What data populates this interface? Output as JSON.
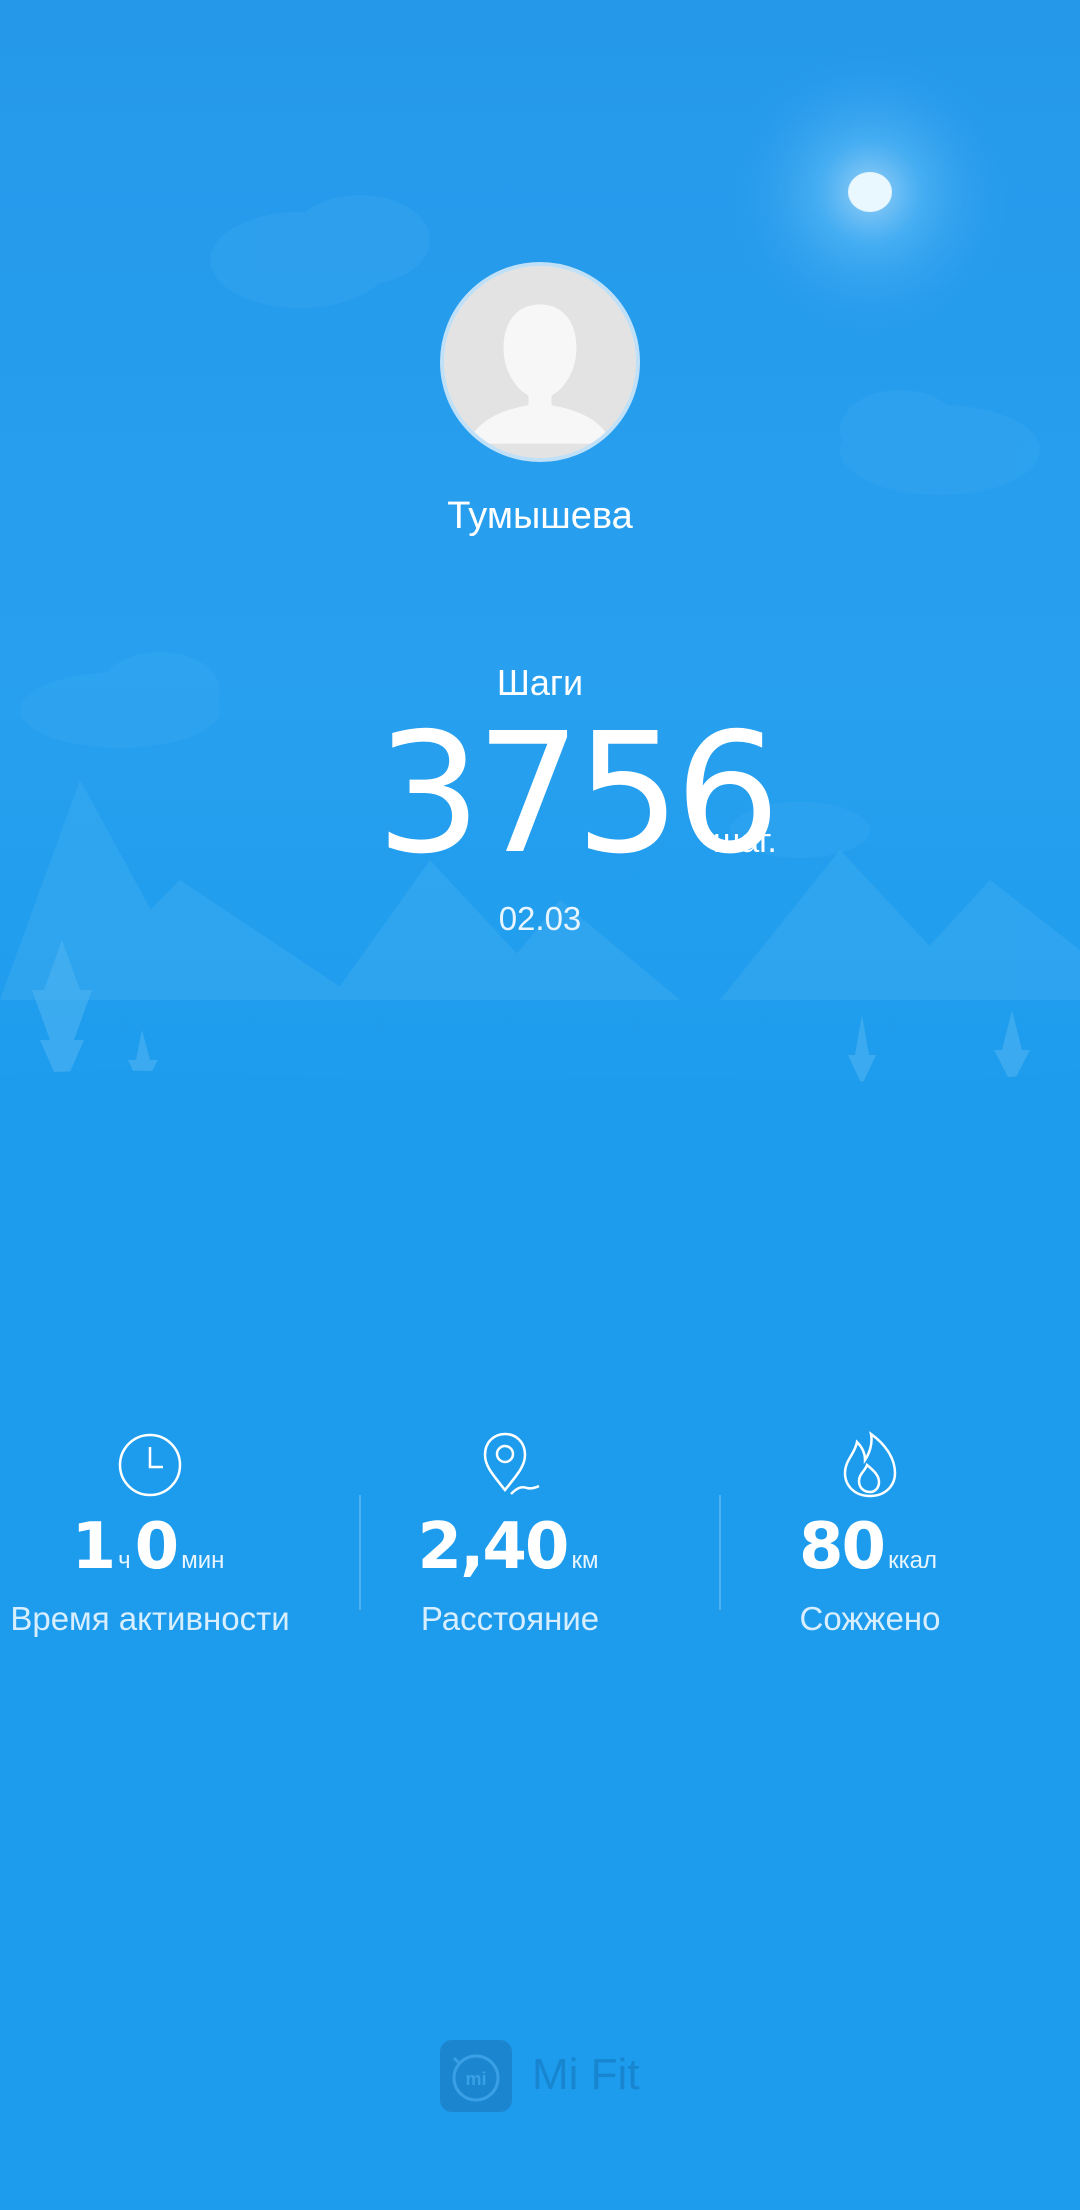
{
  "profile": {
    "username": "Тумышева",
    "avatar_icon": "default-avatar-icon"
  },
  "steps": {
    "label": "Шаги",
    "value": "3756",
    "unit": "шаг.",
    "date": "02.03"
  },
  "stats": {
    "activity": {
      "icon": "clock-icon",
      "hours": "1",
      "hours_unit": "ч",
      "minutes": "0",
      "minutes_unit": "мин",
      "caption": "Время активности"
    },
    "distance": {
      "icon": "location-pin-icon",
      "value": "2,40",
      "unit": "км",
      "caption": "Расстояние"
    },
    "calories": {
      "icon": "flame-icon",
      "value": "80",
      "unit": "ккал",
      "caption": "Сожжено"
    }
  },
  "footer": {
    "logo_icon": "mi-logo-icon",
    "app_name": "Mi Fit"
  },
  "colors": {
    "background": "#1d9ced",
    "text": "#ffffff"
  }
}
